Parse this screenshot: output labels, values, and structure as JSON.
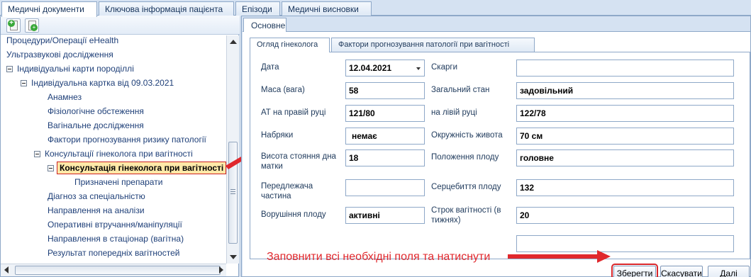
{
  "top_tabs": [
    "Медичні документи",
    "Ключова інформація пацієнта",
    "Епізоди",
    "Медичні висновки"
  ],
  "tree": {
    "items": [
      {
        "label": "Процедури/Операції eHealth"
      },
      {
        "label": "Ультразвукові дослідження"
      },
      {
        "label": "Індивідуальні карти породіллі"
      },
      {
        "label": "Індивідуальна картка від 09.03.2021"
      },
      {
        "label": "Анамнез"
      },
      {
        "label": "Фізіологічне обстеження"
      },
      {
        "label": "Вагінальне дослідження"
      },
      {
        "label": "Фактори прогнозування ризику патології"
      },
      {
        "label": "Консультації гінеколога при вагітності"
      },
      {
        "label": "Консультація гінеколога при вагітності"
      },
      {
        "label": "Призначені препарати"
      },
      {
        "label": "Діагноз за спеціальністю"
      },
      {
        "label": "Направлення на аналізи"
      },
      {
        "label": "Оперативні втручання/маніпуляції"
      },
      {
        "label": "Направлення в стаціонар (вагітна)"
      },
      {
        "label": "Результат попередніх вагітностей"
      }
    ]
  },
  "inner_tab": "Основне",
  "sub_tabs": [
    "Огляд гінеколога",
    "Фактори прогнозування патології при вагітності"
  ],
  "form": {
    "date_label": "Дата",
    "date_value": "12.04.2021",
    "complaints_label": "Скарги",
    "complaints_value": "",
    "weight_label": "Маса (вага)",
    "weight_value": "58",
    "general_label": "Загальний стан",
    "general_value": "задовільний",
    "bp_right_label": "АТ на правій руці",
    "bp_right_value": "121/80",
    "bp_left_label": "на лівій руці",
    "bp_left_value": "122/78",
    "edema_label": "Набряки",
    "edema_value": "немає",
    "waist_label": "Окружність живота",
    "waist_value": "70 см",
    "fundus_label": "Висота стояння дна матки",
    "fundus_value": "18",
    "position_label": "Положення плоду",
    "position_value": "головне",
    "presenting_label": "Передлежача частина",
    "presenting_value": "",
    "heartbeat_label": "Серцебиття плоду",
    "heartbeat_value": "132",
    "movement_label": "Ворушіння плоду",
    "movement_value": "активні",
    "term_label": "Строк вагітності (в тижнях)",
    "term_value": "20"
  },
  "buttons": {
    "save": "Зберегти",
    "cancel": "Скасувати",
    "next": "Далі"
  },
  "annotation": "Заповнити всі необхідні поля та натиснути",
  "colors": {
    "annotation_red": "#e0282d",
    "selected_bg": "#ffe9a8",
    "border": "#8ea8c8"
  }
}
